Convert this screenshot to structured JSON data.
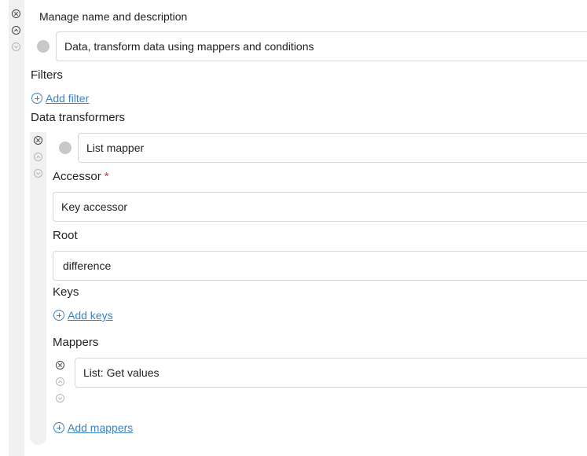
{
  "header": {
    "title": "Manage name and description"
  },
  "name_field": {
    "value": "Data, transform data using mappers and conditions"
  },
  "filters": {
    "label": "Filters",
    "add_label": "Add filter"
  },
  "transformers": {
    "label": "Data transformers",
    "item": {
      "name_value": "List mapper",
      "accessor": {
        "label": "Accessor",
        "required_mark": "*",
        "value": "Key accessor"
      },
      "root": {
        "label": "Root",
        "value": "difference"
      },
      "keys": {
        "label": "Keys",
        "add_label": "Add keys"
      },
      "mappers": {
        "label": "Mappers",
        "items": [
          {
            "value": "List: Get values"
          }
        ],
        "add_label": "Add mappers"
      }
    }
  },
  "icons": {
    "remove": "close-circle-icon",
    "move_up": "chevron-up-circle-icon",
    "move_down": "chevron-down-circle-icon",
    "add": "plus-circle-icon"
  },
  "colors": {
    "link": "#3b83c6",
    "required": "#dd3333",
    "sidebar": "#f1f1f1"
  }
}
